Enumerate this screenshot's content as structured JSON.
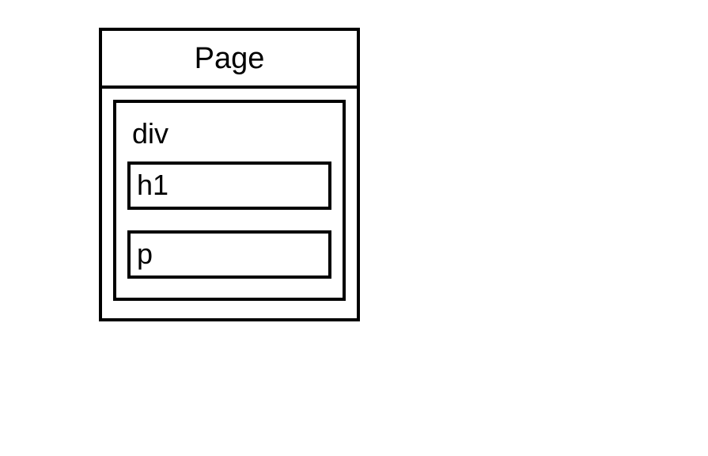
{
  "diagram": {
    "title": "Page",
    "container": {
      "label": "div",
      "children": [
        {
          "label": "h1"
        },
        {
          "label": "p"
        }
      ]
    }
  }
}
